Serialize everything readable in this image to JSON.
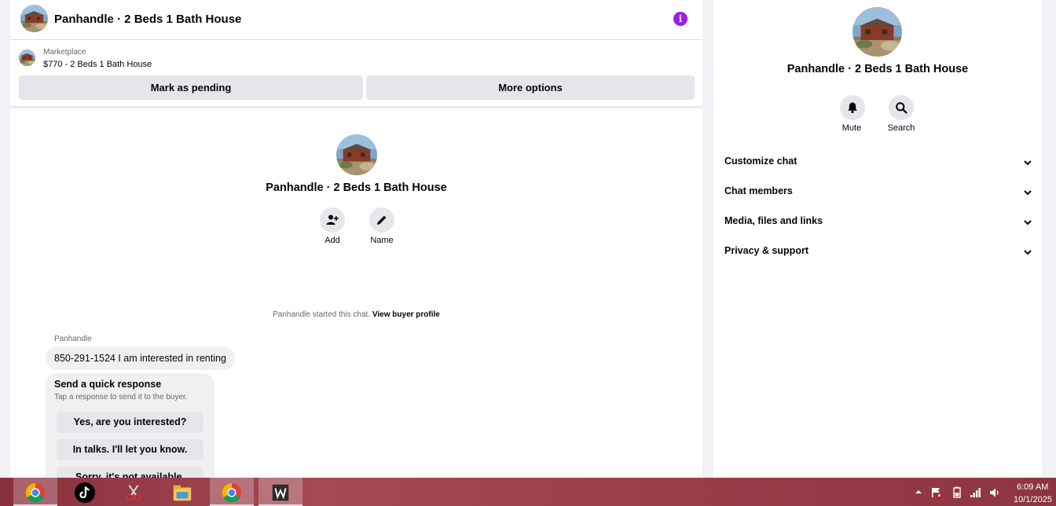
{
  "header": {
    "title": "Panhandle · 2 Beds 1 Bath House",
    "info_icon": "info-icon"
  },
  "listing": {
    "source": "Marketplace",
    "title": "$770 - 2 Beds 1 Bath House",
    "mark_pending_label": "Mark as pending",
    "more_options_label": "More options"
  },
  "chat_intro": {
    "title": "Panhandle · 2 Beds 1 Bath House",
    "add_label": "Add",
    "name_label": "Name",
    "started_text": "Panhandle started this chat.",
    "view_profile_label": "View buyer profile"
  },
  "message": {
    "sender": "Panhandle",
    "text": "850-291-1524 I am interested in renting"
  },
  "quick_response": {
    "title": "Send a quick response",
    "subtitle": "Tap a response to send it to the buyer.",
    "options": [
      "Yes, are you interested?",
      "In talks. I'll let you know.",
      "Sorry, it's not available."
    ]
  },
  "side_panel": {
    "title": "Panhandle · 2 Beds 1 Bath House",
    "mute_label": "Mute",
    "search_label": "Search",
    "sections": [
      "Customize chat",
      "Chat members",
      "Media, files and links",
      "Privacy & support"
    ]
  },
  "taskbar": {
    "apps": [
      "chrome",
      "tiktok",
      "snipping-tool",
      "file-explorer",
      "chrome-profile",
      "writer"
    ],
    "time": "6:09 AM",
    "date": "10/1/2025"
  },
  "colors": {
    "accent": "#9c1de7",
    "button_gray": "#e4e6eb",
    "taskbar": "#9b3f4a"
  }
}
